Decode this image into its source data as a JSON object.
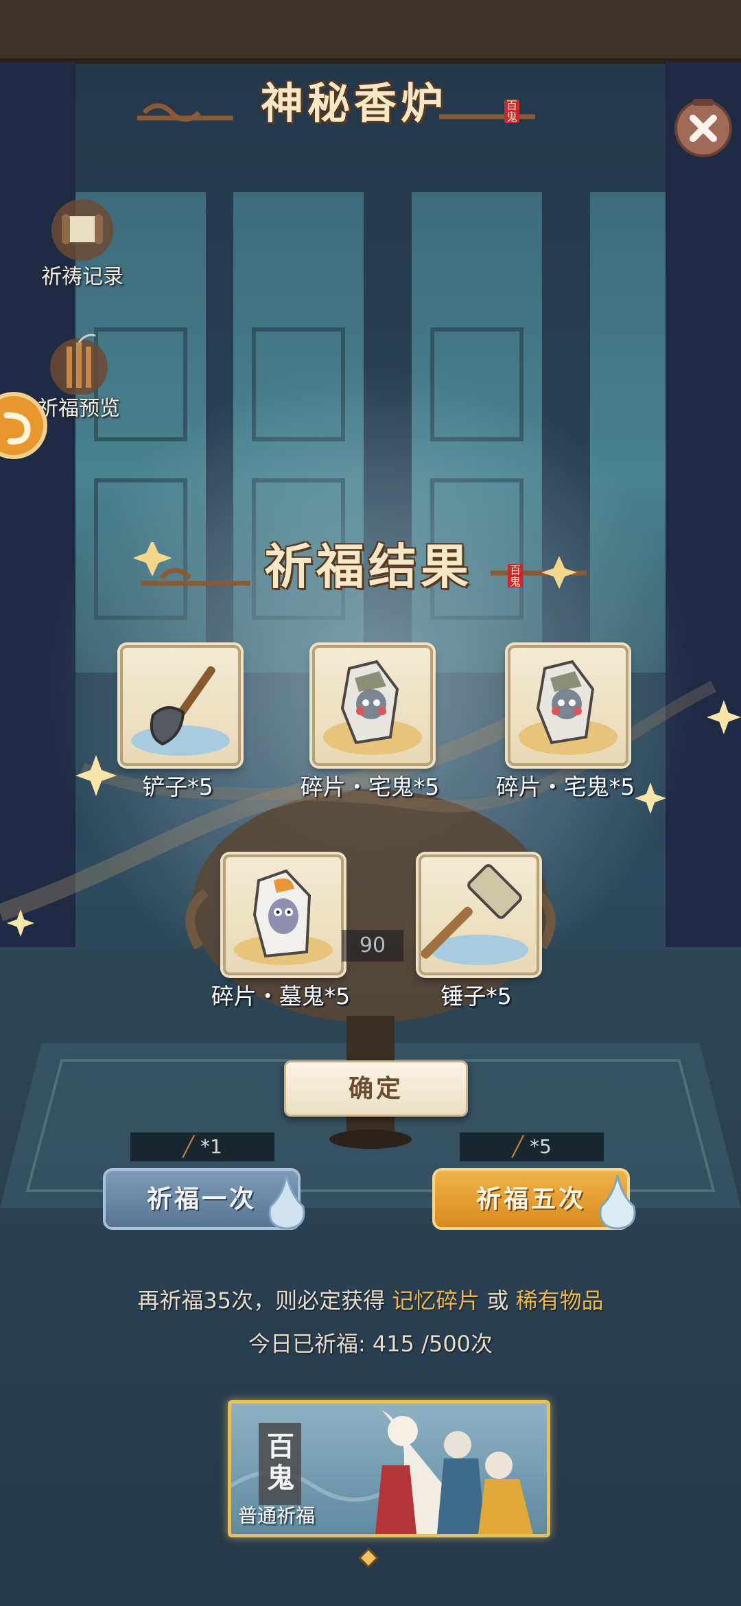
{
  "header": {
    "title": "神秘香炉",
    "seal_text": "百鬼"
  },
  "side_menu": {
    "prayer_record_label": "祈祷记录",
    "blessing_preview_label": "祈福预览"
  },
  "result": {
    "title": "祈福结果",
    "seal_text": "百鬼",
    "items": [
      {
        "label": "铲子*5",
        "icon": "shovel-icon"
      },
      {
        "label": "碎片・宅鬼*5",
        "icon": "house-ghost-fragment-icon"
      },
      {
        "label": "碎片・宅鬼*5",
        "icon": "house-ghost-fragment-icon"
      },
      {
        "label": "碎片・墓鬼*5",
        "icon": "tomb-ghost-fragment-icon"
      },
      {
        "label": "锤子*5",
        "icon": "hammer-icon"
      }
    ],
    "burner_number": "90",
    "confirm_label": "确定"
  },
  "pray": {
    "one": {
      "cost": "*1",
      "label": "祈福一次"
    },
    "five": {
      "cost": "*5",
      "label": "祈福五次"
    }
  },
  "info": {
    "guarantee_prefix": "再祈福35次，则必定获得",
    "reward_a": "记忆碎片",
    "conj": "或",
    "reward_b": "稀有物品",
    "today_label": "今日已祈福:",
    "today_count": "415 /500次"
  },
  "banner": {
    "seal": "百\n鬼",
    "label": "普通祈福"
  },
  "colors": {
    "accent_gold": "#f0b84a",
    "seal_red": "#c8282a"
  }
}
